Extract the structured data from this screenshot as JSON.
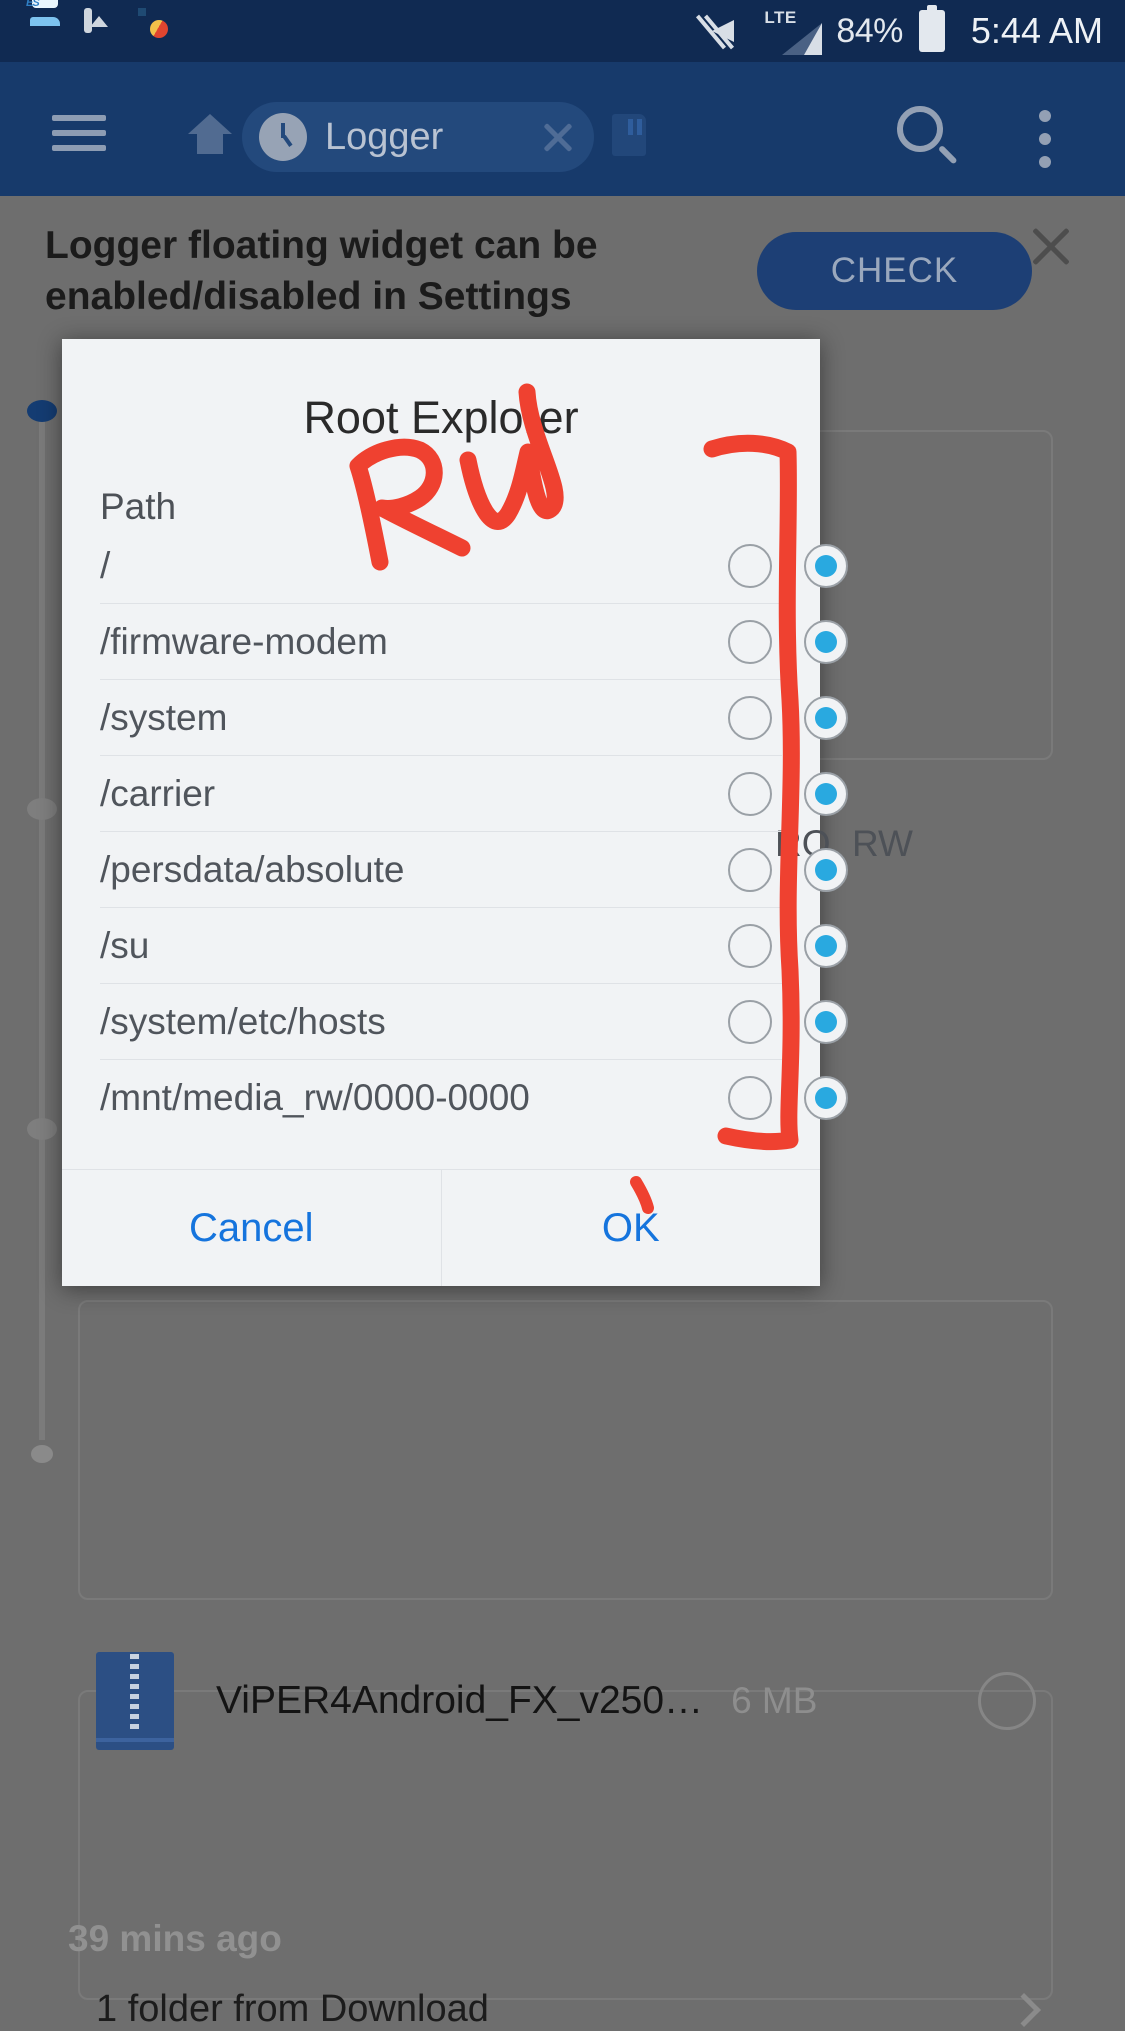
{
  "status_bar": {
    "icons": [
      "es-file-explorer-icon",
      "screenshot-icon",
      "gear-icon",
      "shield-icon"
    ],
    "mute_icon": "mute-icon",
    "network_label": "LTE",
    "signal_icon": "signal-bars-icon",
    "battery_percent": "84%",
    "battery_icon": "battery-icon",
    "time": "5:44 AM"
  },
  "toolbar": {
    "menu_icon": "hamburger-menu-icon",
    "home_icon": "home-icon",
    "chip": {
      "clock_icon": "clock-icon",
      "label": "Logger",
      "close_icon": "close-icon"
    },
    "sdcard_icon": "sdcard-icon",
    "search_icon": "search-icon",
    "overflow_icon": "overflow-menu-icon"
  },
  "promo_banner": {
    "message": "Logger floating widget can be enabled/disabled in Settings",
    "action_label": "CHECK",
    "close_icon": "close-icon"
  },
  "dialog": {
    "title": "Root Explorer",
    "columns": {
      "path": "Path",
      "ro": "RO",
      "rw": "RW"
    },
    "rows": [
      {
        "path": "/",
        "mode": "RW"
      },
      {
        "path": "/firmware-modem",
        "mode": "RW"
      },
      {
        "path": "/system",
        "mode": "RW"
      },
      {
        "path": "/carrier",
        "mode": "RW"
      },
      {
        "path": "/persdata/absolute",
        "mode": "RW"
      },
      {
        "path": "/su",
        "mode": "RW"
      },
      {
        "path": "/system/etc/hosts",
        "mode": "RW"
      },
      {
        "path": "/mnt/media_rw/0000-0000",
        "mode": "RW"
      }
    ],
    "cancel_label": "Cancel",
    "ok_label": "OK"
  },
  "background": {
    "file_row": {
      "icon": "zip-file-icon",
      "name": "ViPER4Android_FX_v250…",
      "size": "6 MB",
      "checkbox": "unchecked"
    },
    "timestamp": "39 mins ago",
    "folder_row": {
      "text": "1 folder from Download",
      "chevron": "chevron-right-icon"
    }
  },
  "annotation": {
    "text": "RW",
    "color": "#ef4130",
    "description": "hand-drawn red RW label and bracket highlighting the RW column"
  },
  "colors": {
    "status_bar": "#102a52",
    "toolbar": "#173a6b",
    "scrim": "#6e6e6e",
    "dialog_bg": "#f1f3f5",
    "accent_link": "#1574dd",
    "radio_checked": "#29a9e0",
    "annotation_red": "#ef4130"
  }
}
